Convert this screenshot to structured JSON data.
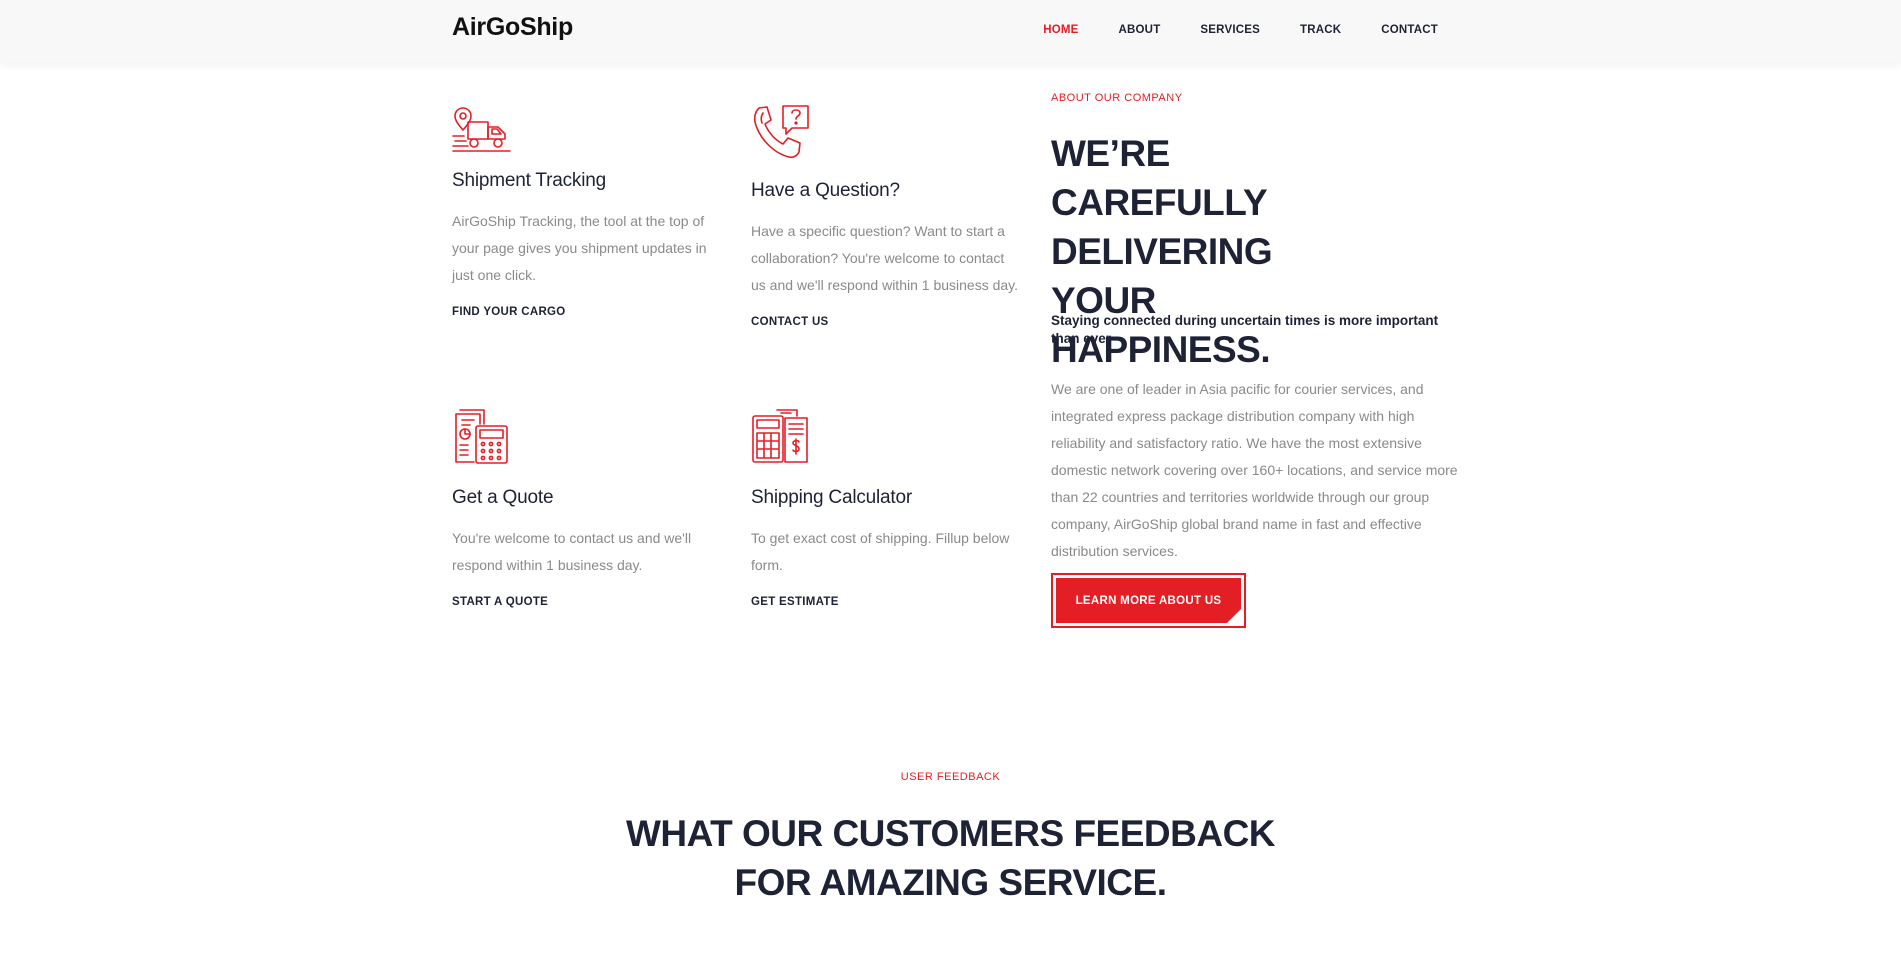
{
  "header": {
    "logo": "AirGoShip",
    "nav": [
      {
        "label": "HOME",
        "active": true
      },
      {
        "label": "ABOUT",
        "active": false
      },
      {
        "label": "SERVICES",
        "active": false
      },
      {
        "label": "TRACK",
        "active": false
      },
      {
        "label": "CONTACT",
        "active": false
      }
    ]
  },
  "services": [
    {
      "icon": "truck-location-icon",
      "title": "Shipment Tracking",
      "text": "AirGoShip Tracking, the tool at the top of your page gives you shipment updates in just one click.",
      "link": "FIND YOUR CARGO"
    },
    {
      "icon": "phone-question-icon",
      "title": "Have a Question?",
      "text": "Have a specific question? Want to start a collaboration? You're welcome to contact us and we'll respond within 1 business day.",
      "link": "CONTACT US"
    },
    {
      "icon": "quote-calculator-icon",
      "title": "Get a Quote",
      "text": "You're welcome to contact us and we'll respond within 1 business day.",
      "link": "START A QUOTE"
    },
    {
      "icon": "shipping-calculator-icon",
      "title": "Shipping Calculator",
      "text": "To get exact cost of shipping. Fillup below form.",
      "link": "GET ESTIMATE"
    }
  ],
  "about": {
    "eyebrow": "ABOUT OUR COMPANY",
    "title": "WE’RE CAREFULLY DELIVERING YOUR HAPPINESS.",
    "subtitle": "Staying connected during uncertain times is more important than ever",
    "body": "We are one of leader in Asia pacific for courier services, and integrated express package distribution company with high reliability and satisfactory ratio. We have the most extensive domestic network covering over 160+ locations, and service more than 22 countries and territories worldwide through our group company, AirGoShip global brand name in fast and effective distribution services.",
    "button": "LEARN MORE ABOUT US"
  },
  "feedback": {
    "eyebrow": "USER FEEDBACK",
    "title_line1": "WHAT OUR CUSTOMERS FEEDBACK",
    "title_line2": "FOR AMAZING SERVICE."
  },
  "colors": {
    "accent": "#e31e24",
    "heading": "#1e2235",
    "body_text": "#8a8a8a",
    "header_bg": "#f8f8f8"
  }
}
